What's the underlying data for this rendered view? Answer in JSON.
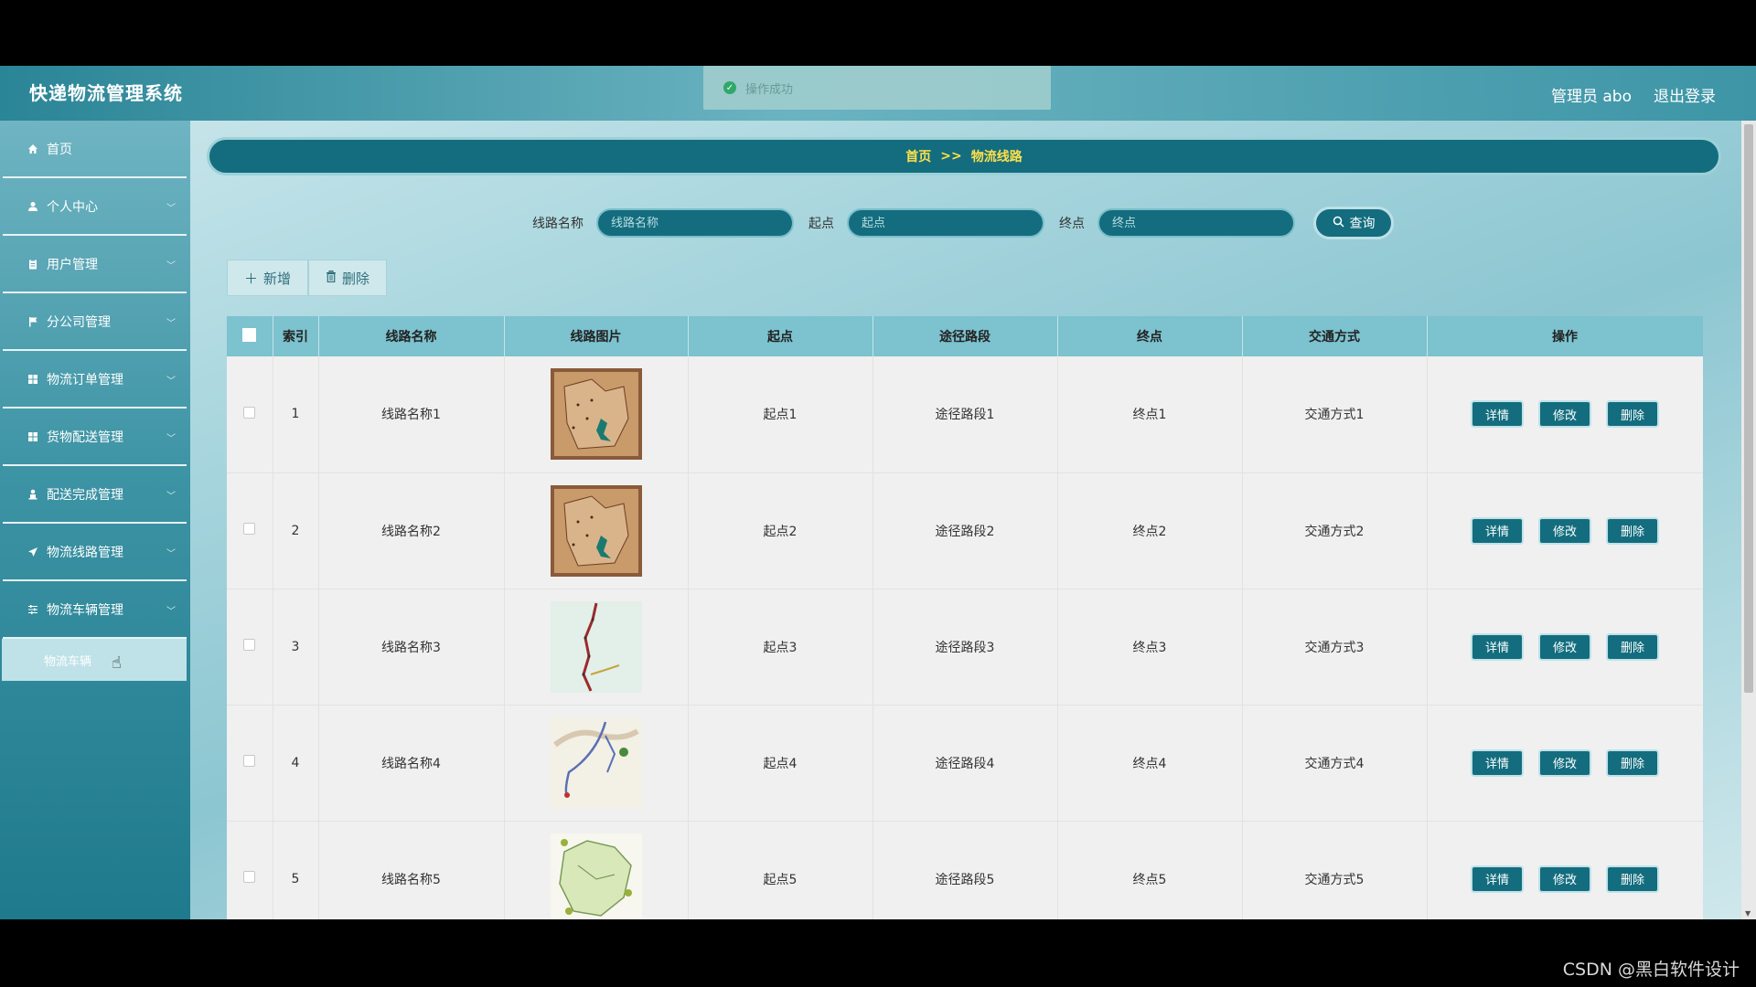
{
  "app": {
    "title": "快递物流管理系统"
  },
  "header": {
    "user_label": "管理员 abo",
    "logout_label": "退出登录"
  },
  "toast": {
    "message": "操作成功"
  },
  "sidebar": {
    "items": [
      {
        "label": "首页",
        "icon": "home-icon",
        "has_children": false
      },
      {
        "label": "个人中心",
        "icon": "user-icon",
        "has_children": true
      },
      {
        "label": "用户管理",
        "icon": "clipboard-icon",
        "has_children": true
      },
      {
        "label": "分公司管理",
        "icon": "flag-icon",
        "has_children": true
      },
      {
        "label": "物流订单管理",
        "icon": "grid-icon",
        "has_children": true
      },
      {
        "label": "货物配送管理",
        "icon": "grid-icon",
        "has_children": true
      },
      {
        "label": "配送完成管理",
        "icon": "person-icon",
        "has_children": true
      },
      {
        "label": "物流线路管理",
        "icon": "send-icon",
        "has_children": true
      },
      {
        "label": "物流车辆管理",
        "icon": "sliders-icon",
        "has_children": true
      }
    ],
    "active_sub": {
      "label": "物流车辆"
    }
  },
  "breadcrumb": {
    "home": "首页",
    "separator": ">>",
    "current": "物流线路"
  },
  "search": {
    "route_label": "线路名称",
    "route_placeholder": "线路名称",
    "start_label": "起点",
    "start_placeholder": "起点",
    "end_label": "终点",
    "end_placeholder": "终点",
    "query_label": "查询"
  },
  "actions": {
    "add_label": "新增",
    "delete_label": "删除"
  },
  "table": {
    "headers": [
      "索引",
      "线路名称",
      "线路图片",
      "起点",
      "途径路段",
      "终点",
      "交通方式",
      "操作"
    ],
    "rows": [
      {
        "index": "1",
        "name": "线路名称1",
        "image": "old-map",
        "start": "起点1",
        "via": "途径路段1",
        "end": "终点1",
        "transport": "交通方式1"
      },
      {
        "index": "2",
        "name": "线路名称2",
        "image": "old-map",
        "start": "起点2",
        "via": "途径路段2",
        "end": "终点2",
        "transport": "交通方式2"
      },
      {
        "index": "3",
        "name": "线路名称3",
        "image": "route-map",
        "start": "起点3",
        "via": "途径路段3",
        "end": "终点3",
        "transport": "交通方式3"
      },
      {
        "index": "4",
        "name": "线路名称4",
        "image": "road-map",
        "start": "起点4",
        "via": "途径路段4",
        "end": "终点4",
        "transport": "交通方式4"
      },
      {
        "index": "5",
        "name": "线路名称5",
        "image": "region-map",
        "start": "起点5",
        "via": "途径路段5",
        "end": "终点5",
        "transport": "交通方式5"
      }
    ],
    "op_labels": {
      "detail": "详情",
      "edit": "修改",
      "delete": "删除"
    }
  },
  "watermark": "CSDN @黑白软件设计",
  "colors": {
    "primary": "#136d7e",
    "header_row": "#7cc2cf",
    "breadcrumb_text": "#ffe04a",
    "toast_icon": "#2fa86a"
  }
}
